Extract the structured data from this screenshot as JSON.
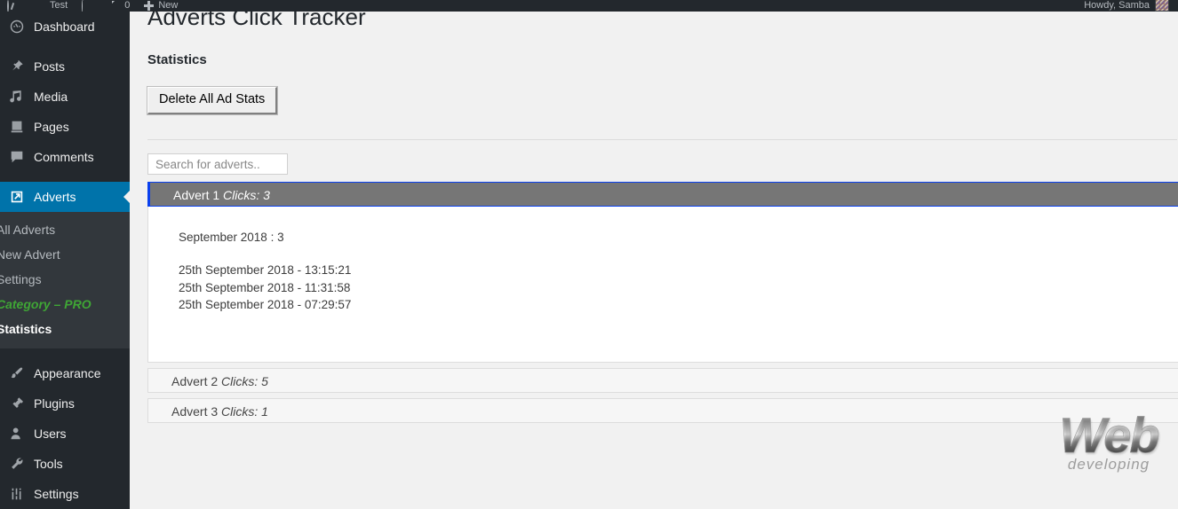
{
  "adminbar": {
    "items": [
      {
        "icon": "wordpress-logo-icon",
        "label": ""
      },
      {
        "icon": "home-icon",
        "label": "Test"
      },
      {
        "icon": "refresh-icon",
        "label": ""
      },
      {
        "icon": "comment-icon",
        "label": "0"
      },
      {
        "icon": "plus-icon",
        "label": "New"
      }
    ],
    "howdy": "Howdy, Samba"
  },
  "sidebar": {
    "items": [
      {
        "label": "Dashboard",
        "icon": "dashboard-icon",
        "current": false
      },
      {
        "label": "Posts",
        "icon": "pin-icon",
        "current": false
      },
      {
        "label": "Media",
        "icon": "media-icon",
        "current": false
      },
      {
        "label": "Pages",
        "icon": "page-icon",
        "current": false
      },
      {
        "label": "Comments",
        "icon": "comment-icon",
        "current": false
      },
      {
        "label": "Adverts",
        "icon": "external-link-icon",
        "current": true
      },
      {
        "label": "Appearance",
        "icon": "brush-icon",
        "current": false
      },
      {
        "label": "Plugins",
        "icon": "plug-icon",
        "current": false
      },
      {
        "label": "Users",
        "icon": "user-icon",
        "current": false
      },
      {
        "label": "Tools",
        "icon": "wrench-icon",
        "current": false
      },
      {
        "label": "Settings",
        "icon": "sliders-icon",
        "current": false
      }
    ],
    "submenu": [
      {
        "label": "All Adverts",
        "style": "normal"
      },
      {
        "label": "New Advert",
        "style": "normal"
      },
      {
        "label": "Settings",
        "style": "normal"
      },
      {
        "label": "Category – PRO",
        "style": "pro"
      },
      {
        "label": "Statistics",
        "style": "current"
      }
    ]
  },
  "page": {
    "title": "Adverts Click Tracker",
    "subtitle": "Statistics",
    "delete_button": "Delete All Ad Stats"
  },
  "search": {
    "placeholder": "Search for adverts..",
    "value": ""
  },
  "adverts": [
    {
      "name": "Advert 1",
      "clicks_label": "Clicks: 3",
      "expanded": true,
      "month_summary": "September 2018 : 3",
      "clicks": [
        "25th September 2018 - 13:15:21",
        "25th September 2018 - 11:31:58",
        "25th September 2018 - 07:29:57"
      ]
    },
    {
      "name": "Advert 2",
      "clicks_label": "Clicks: 5",
      "expanded": false,
      "month_summary": "",
      "clicks": []
    },
    {
      "name": "Advert 3",
      "clicks_label": "Clicks: 1",
      "expanded": false,
      "month_summary": "",
      "clicks": []
    }
  ],
  "watermark": {
    "line1": "Web",
    "line2": "developing"
  },
  "colors": {
    "admin_bar": "#23282d",
    "sidebar": "#23282d",
    "submenu": "#32373c",
    "current_menu": "#0073aa",
    "pro_green": "#3fa635",
    "accordion_active_bg": "#767676",
    "accordion_active_border": "#0a40ee",
    "content_bg": "#f1f1f1"
  }
}
